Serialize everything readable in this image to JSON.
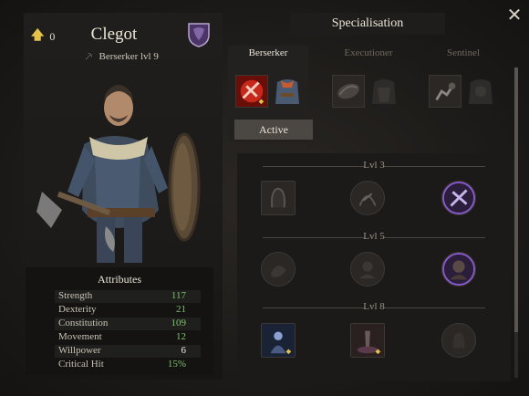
{
  "character": {
    "perk_points": "0",
    "name": "Clegot",
    "class_level": "Berserker lvl 9"
  },
  "attributes": {
    "title": "Attributes",
    "rows": [
      {
        "name": "Strength",
        "value": "117",
        "color": "#7cc26a"
      },
      {
        "name": "Dexterity",
        "value": "21",
        "color": "#7cc26a"
      },
      {
        "name": "Constitution",
        "value": "109",
        "color": "#7cc26a"
      },
      {
        "name": "Movement",
        "value": "12",
        "color": "#7cc26a"
      },
      {
        "name": "Willpower",
        "value": "6",
        "color": "#f0ece2"
      },
      {
        "name": "Critical Hit",
        "value": "15%",
        "color": "#7cc26a"
      }
    ]
  },
  "specialisation": {
    "title": "Specialisation",
    "tabs": [
      {
        "label": "Berserker",
        "active": true
      },
      {
        "label": "Executioner",
        "active": false
      },
      {
        "label": "Sentinel",
        "active": false
      }
    ],
    "active_label": "Active",
    "levels": [
      {
        "label": "Lvl 3"
      },
      {
        "label": "Lvl 5"
      },
      {
        "label": "Lvl 8"
      }
    ]
  },
  "icons": {
    "close": "close-icon",
    "perk": "arrow-up-icon",
    "class": "axe-icon",
    "crest": "shield-crest-icon"
  },
  "colors": {
    "accent_gold": "#e6c14a",
    "attribute_green": "#7cc26a",
    "crest_purple": "#6a4a8c",
    "skill_red": "#c8281c",
    "skill_purple": "#8a5ad0"
  }
}
